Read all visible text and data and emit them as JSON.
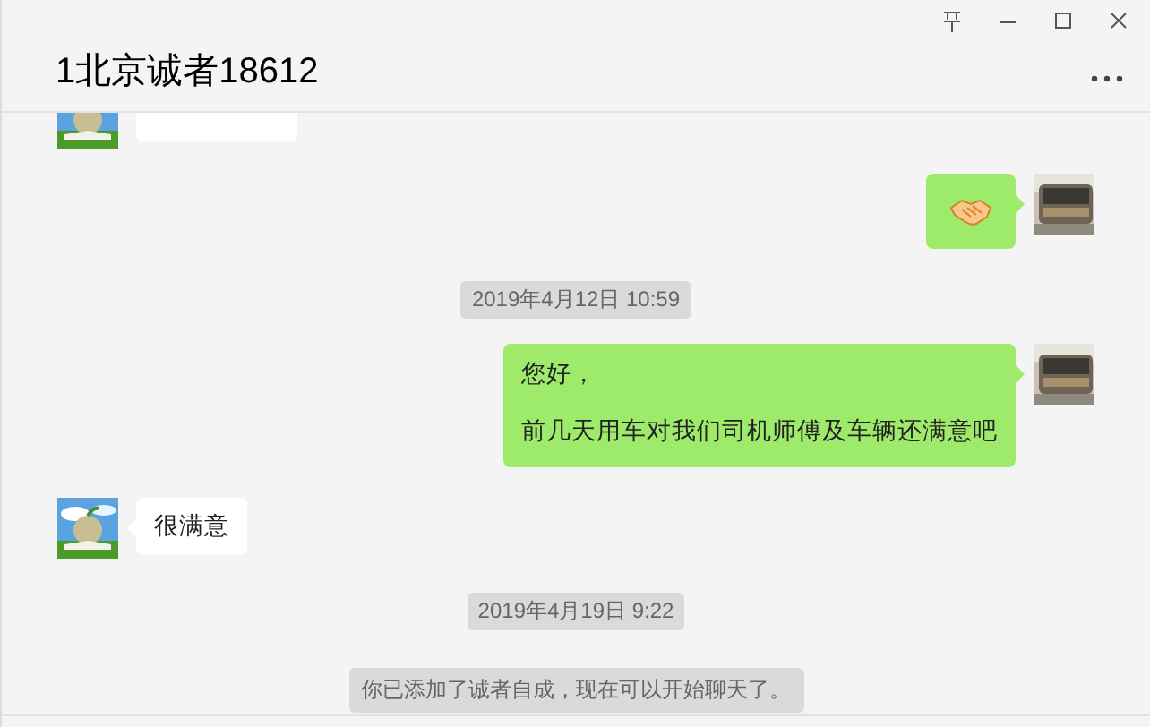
{
  "window": {
    "title": "1北京诚者18612"
  },
  "messages": [
    {
      "kind": "incoming_cut"
    },
    {
      "kind": "sticker"
    },
    {
      "kind": "time",
      "text": "2019年4月12日 10:59"
    },
    {
      "kind": "outgoing",
      "lines": [
        "您好，",
        "前几天用车对我们司机师傅及车辆还满意吧"
      ]
    },
    {
      "kind": "incoming",
      "lines": [
        "很满意"
      ]
    },
    {
      "kind": "time",
      "text": "2019年4月19日 9:22"
    },
    {
      "kind": "system",
      "text": "你已添加了诚者自成，现在可以开始聊天了。"
    }
  ]
}
